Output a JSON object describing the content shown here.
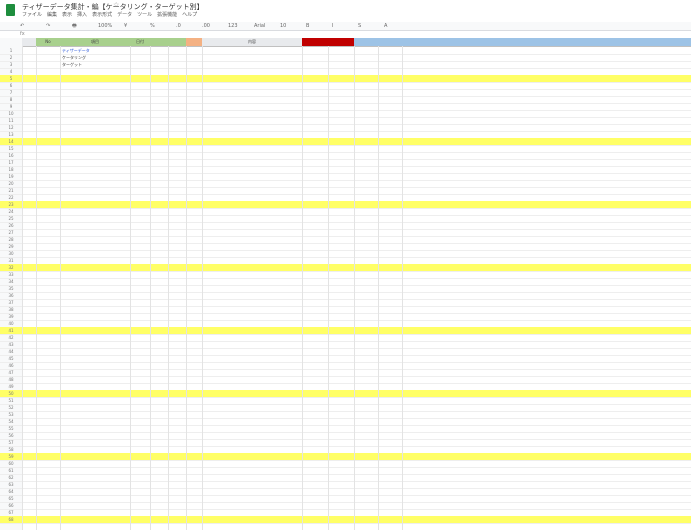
{
  "app": {
    "title": "ティザーデータ集計・編【ケータリング・ターゲット別】",
    "menu": [
      "ファイル",
      "編集",
      "表示",
      "挿入",
      "表示形式",
      "データ",
      "ツール",
      "拡張機能",
      "ヘルプ"
    ]
  },
  "toolbar": {
    "items": [
      "↶",
      "↷",
      "🖶",
      "100%",
      "¥",
      "%",
      ".0",
      ".00",
      "123",
      "Arial",
      "10",
      "B",
      "I",
      "S",
      "A"
    ]
  },
  "formula": {
    "fx": "fx"
  },
  "colors": {
    "header_bg": "#e8eaed",
    "green_header": "#a8d08d",
    "highlight_orange": "#f4b183",
    "red_header": "#c00000",
    "blue_header": "#9dc3e6",
    "text_blue": "#1f4ed8",
    "text_red": "#d32f2f",
    "row_yellow": "#ffff66"
  },
  "columns": [
    {
      "label": "",
      "color": "#e8eaed"
    },
    {
      "label": "No",
      "color": "#a8d08d"
    },
    {
      "label": "項目",
      "color": "#a8d08d"
    },
    {
      "label": "日付",
      "color": "#a8d08d"
    },
    {
      "label": "",
      "color": "#a8d08d"
    },
    {
      "label": "",
      "color": "#a8d08d"
    },
    {
      "label": "",
      "color": "#f4b183"
    },
    {
      "label": "内容",
      "color": "#e8eaed"
    },
    {
      "label": "",
      "color": "#c00000"
    },
    {
      "label": "",
      "color": "#c00000"
    },
    {
      "label": "",
      "color": "#9dc3e6"
    },
    {
      "label": "",
      "color": "#9dc3e6"
    },
    {
      "label": "",
      "color": "#9dc3e6"
    }
  ],
  "rows": [
    {
      "n": "1",
      "text": "ティザーデータ"
    },
    {
      "n": "2",
      "text": "ケータリング"
    },
    {
      "n": "3",
      "text": "ターゲット"
    },
    {
      "n": "4",
      "text": ""
    },
    {
      "n": "5",
      "text": ""
    },
    {
      "n": "6",
      "text": ""
    },
    {
      "n": "7",
      "text": ""
    },
    {
      "n": "8",
      "text": ""
    },
    {
      "n": "9",
      "text": ""
    },
    {
      "n": "10",
      "text": ""
    },
    {
      "n": "11",
      "text": ""
    },
    {
      "n": "12",
      "text": ""
    },
    {
      "n": "13",
      "text": ""
    },
    {
      "n": "14",
      "text": ""
    },
    {
      "n": "15",
      "text": ""
    },
    {
      "n": "16",
      "text": ""
    },
    {
      "n": "17",
      "text": ""
    },
    {
      "n": "18",
      "text": ""
    },
    {
      "n": "19",
      "text": ""
    },
    {
      "n": "20",
      "text": ""
    },
    {
      "n": "21",
      "text": ""
    },
    {
      "n": "22",
      "text": ""
    },
    {
      "n": "23",
      "text": ""
    },
    {
      "n": "24",
      "text": ""
    },
    {
      "n": "25",
      "text": ""
    },
    {
      "n": "26",
      "text": ""
    },
    {
      "n": "27",
      "text": ""
    },
    {
      "n": "28",
      "text": ""
    },
    {
      "n": "29",
      "text": ""
    },
    {
      "n": "30",
      "text": ""
    },
    {
      "n": "31",
      "text": ""
    },
    {
      "n": "32",
      "text": ""
    },
    {
      "n": "33",
      "text": ""
    },
    {
      "n": "34",
      "text": ""
    },
    {
      "n": "35",
      "text": ""
    },
    {
      "n": "36",
      "text": ""
    },
    {
      "n": "37",
      "text": ""
    },
    {
      "n": "38",
      "text": ""
    },
    {
      "n": "39",
      "text": ""
    },
    {
      "n": "40",
      "text": ""
    },
    {
      "n": "41",
      "text": ""
    },
    {
      "n": "42",
      "text": ""
    },
    {
      "n": "43",
      "text": ""
    },
    {
      "n": "44",
      "text": ""
    },
    {
      "n": "45",
      "text": ""
    },
    {
      "n": "46",
      "text": ""
    },
    {
      "n": "47",
      "text": ""
    },
    {
      "n": "48",
      "text": ""
    },
    {
      "n": "49",
      "text": ""
    },
    {
      "n": "50",
      "text": ""
    },
    {
      "n": "51",
      "text": ""
    },
    {
      "n": "52",
      "text": ""
    },
    {
      "n": "53",
      "text": ""
    },
    {
      "n": "54",
      "text": ""
    },
    {
      "n": "55",
      "text": ""
    },
    {
      "n": "56",
      "text": ""
    },
    {
      "n": "57",
      "text": ""
    },
    {
      "n": "58",
      "text": ""
    },
    {
      "n": "59",
      "text": ""
    },
    {
      "n": "60",
      "text": ""
    },
    {
      "n": "61",
      "text": ""
    },
    {
      "n": "62",
      "text": ""
    },
    {
      "n": "63",
      "text": ""
    },
    {
      "n": "64",
      "text": ""
    },
    {
      "n": "65",
      "text": ""
    },
    {
      "n": "66",
      "text": ""
    },
    {
      "n": "67",
      "text": ""
    },
    {
      "n": "68",
      "text": ""
    }
  ]
}
